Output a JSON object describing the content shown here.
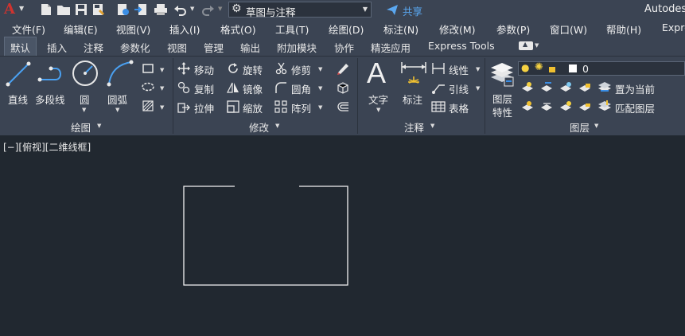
{
  "app": {
    "title": "Autodes",
    "logo": "A"
  },
  "workspace": {
    "value": "草图与注释",
    "icon": "gear-icon"
  },
  "share": {
    "label": "共享"
  },
  "menu": [
    "文件(F)",
    "编辑(E)",
    "视图(V)",
    "插入(I)",
    "格式(O)",
    "工具(T)",
    "绘图(D)",
    "标注(N)",
    "修改(M)",
    "参数(P)",
    "窗口(W)",
    "帮助(H)",
    "Expre"
  ],
  "tabs": [
    "默认",
    "插入",
    "注释",
    "参数化",
    "视图",
    "管理",
    "输出",
    "附加模块",
    "协作",
    "精选应用",
    "Express Tools"
  ],
  "ribbon": {
    "draw": {
      "title": "绘图",
      "line": "直线",
      "polyline": "多段线",
      "circle": "圆",
      "arc": "圆弧"
    },
    "modify": {
      "title": "修改",
      "move": "移动",
      "rotate": "旋转",
      "trim": "修剪",
      "copy": "复制",
      "mirror": "镜像",
      "fillet": "圆角",
      "stretch": "拉伸",
      "scale": "缩放",
      "array": "阵列"
    },
    "annotation": {
      "title": "注释",
      "text": "文字",
      "dimension": "标注",
      "linear": "线性",
      "leader": "引线",
      "table": "表格"
    },
    "layers": {
      "title": "图层",
      "properties_line1": "图层",
      "properties_line2": "特性",
      "current_layer": "0",
      "set_current": "置为当前",
      "match": "匹配图层"
    }
  },
  "viewport": {
    "label": "[−][俯视][二维线框]"
  },
  "colors": {
    "accent": "#3a8ee6",
    "background": "#212830",
    "ribbon": "#3b4453",
    "logo": "#d0332f"
  }
}
